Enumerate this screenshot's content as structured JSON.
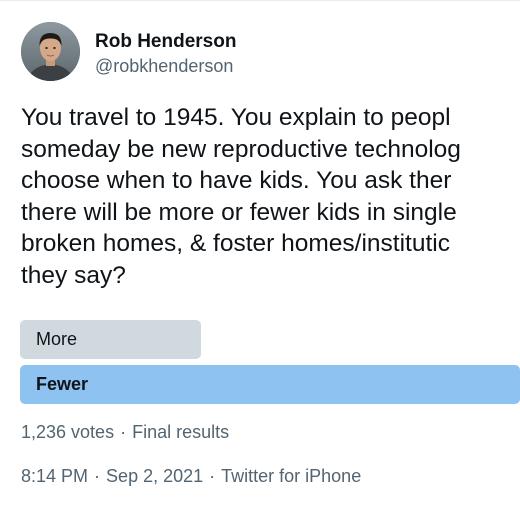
{
  "author": {
    "display_name": "Rob Henderson",
    "handle": "@robkhenderson"
  },
  "tweet": {
    "lines": [
      "You travel to 1945. You explain to peopl",
      "someday be new reproductive technolog",
      "choose when to have kids. You ask ther",
      "there will be more or fewer kids in single",
      "broken homes, & foster homes/institutic",
      "they say?"
    ]
  },
  "poll": {
    "options": [
      {
        "label": "More",
        "winner": false
      },
      {
        "label": "Fewer",
        "winner": true
      }
    ],
    "votes": "1,236 votes",
    "separator": "·",
    "status": "Final results"
  },
  "meta": {
    "time": "8:14 PM",
    "date": "Sep 2, 2021",
    "source": "Twitter for iPhone",
    "separator": "·"
  },
  "colors": {
    "winner_bar": "#8ec2f0",
    "other_bar": "#cfd9de",
    "secondary_text": "#536471"
  }
}
